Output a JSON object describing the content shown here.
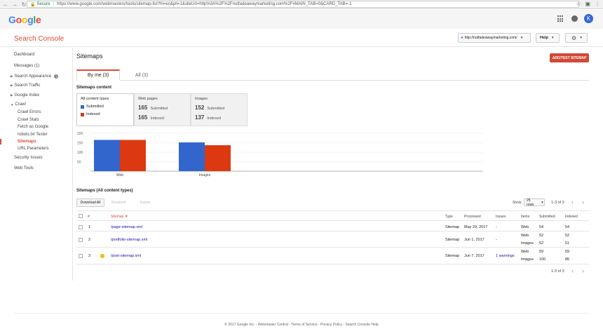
{
  "browser": {
    "secure_label": "Secure",
    "url": "https://www.google.com/webmasters/tools/sitemap-list?hl=en&pli=1&siteUrl=http%3A%2F%2Fnotfadeawaymarketing.com%2F#MAIN_TAB=0&CARD_TAB=-1"
  },
  "header": {
    "logo": [
      "G",
      "o",
      "o",
      "g",
      "l",
      "e"
    ],
    "logo_colors": [
      "#4285f4",
      "#ea4335",
      "#fbbc05",
      "#4285f4",
      "#34a853",
      "#ea4335"
    ],
    "avatar_letter": "K"
  },
  "console": {
    "title": "Search Console",
    "site": "http://notfadeawaymarketing.com/",
    "help": "Help"
  },
  "sidebar": {
    "items": [
      {
        "label": "Dashboard"
      },
      {
        "label": "Messages (1)"
      },
      {
        "label": "Search Appearance"
      },
      {
        "label": "Search Traffic"
      },
      {
        "label": "Google Index"
      },
      {
        "label": "Crawl"
      },
      {
        "label": "Crawl Errors"
      },
      {
        "label": "Crawl Stats"
      },
      {
        "label": "Fetch as Google"
      },
      {
        "label": "robots.txt Tester"
      },
      {
        "label": "Sitemaps"
      },
      {
        "label": "URL Parameters"
      },
      {
        "label": "Security Issues"
      },
      {
        "label": "Web Tools"
      }
    ]
  },
  "main": {
    "title": "Sitemaps",
    "add_button": "ADD/TEST SITEMAP",
    "tabs": [
      {
        "label": "By me (3)"
      },
      {
        "label": "All (3)"
      }
    ],
    "content_label": "Sitemaps content",
    "legend": {
      "title": "All content types",
      "submitted": "Submitted",
      "indexed": "Indexed",
      "submitted_color": "#3366cc",
      "indexed_color": "#dc3912"
    },
    "stats": [
      {
        "title": "Web pages",
        "submitted": "165",
        "indexed": "165",
        "submitted_label": "Submitted",
        "indexed_label": "Indexed"
      },
      {
        "title": "Images",
        "submitted": "152",
        "indexed": "137",
        "submitted_label": "Submitted",
        "indexed_label": "Indexed"
      }
    ]
  },
  "chart_data": {
    "type": "bar",
    "categories": [
      "Web",
      "Images"
    ],
    "series": [
      {
        "name": "Submitted",
        "values": [
          165,
          152
        ]
      },
      {
        "name": "Indexed",
        "values": [
          165,
          137
        ]
      }
    ],
    "yticks": [
      50,
      100,
      150,
      200
    ],
    "ylim": [
      0,
      200
    ],
    "grid": true
  },
  "table": {
    "section_label": "Sitemaps (All content types)",
    "buttons": {
      "download": "Download All",
      "resubmit": "Resubmit",
      "delete": "Delete"
    },
    "show_label": "Show",
    "rows_per_page": "25 rows",
    "range": "1-3 of 3",
    "headers": {
      "num": "#",
      "sitemap": "Sitemap",
      "type": "Type",
      "processed": "Processed",
      "issues": "Issues",
      "items": "Items",
      "submitted": "Submitted",
      "indexed": "Indexed"
    },
    "rows": [
      {
        "num": "1",
        "sitemap": "/page-sitemap.xml",
        "type": "Sitemap",
        "processed": "May 29, 2017",
        "issues": "-",
        "items": [
          {
            "item": "Web",
            "submitted": "54",
            "indexed": "54"
          }
        ]
      },
      {
        "num": "2",
        "sitemap": "/portfolio-sitemap.xml",
        "type": "Sitemap",
        "processed": "Jun 1, 2017",
        "issues": "-",
        "items": [
          {
            "item": "Web",
            "submitted": "52",
            "indexed": "52"
          },
          {
            "item": "Images",
            "submitted": "52",
            "indexed": "51"
          }
        ]
      },
      {
        "num": "3",
        "sitemap": "/post-sitemap.xml",
        "type": "Sitemap",
        "processed": "Jun 7, 2017",
        "issues": "1 warnings",
        "items": [
          {
            "item": "Web",
            "submitted": "59",
            "indexed": "59"
          },
          {
            "item": "Images",
            "submitted": "100",
            "indexed": "86"
          }
        ]
      }
    ]
  },
  "footer": "© 2017 Google Inc. - Webmaster Central - Terms of Service - Privacy Policy - Search Console Help"
}
